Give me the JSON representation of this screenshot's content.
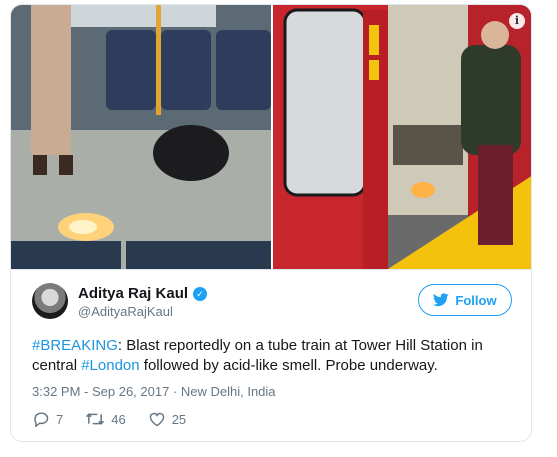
{
  "tweet": {
    "author_name": "Aditya Raj Kaul",
    "handle": "@AdityaRajKaul",
    "follow_label": "Follow",
    "hashtag_breaking": "#BREAKING",
    "text_part1": ": Blast reportedly on a tube train at Tower Hill Station in central ",
    "hashtag_london": "#London",
    "text_part2": " followed by acid-like smell. Probe underway.",
    "timestamp": "3:32 PM - Sep 26, 2017",
    "separator": " · ",
    "location": "New Delhi, India",
    "replies": "7",
    "retweets": "46",
    "likes": "25"
  },
  "colors": {
    "accent": "#1da1f2",
    "link": "#1b95e0",
    "secondary_text": "#657786",
    "border": "#e1e8ed"
  },
  "icons": {
    "verified": "verified-badge-icon",
    "follow": "twitter-bird-icon",
    "reply": "reply-icon",
    "retweet": "retweet-icon",
    "like": "heart-icon",
    "info": "info-icon"
  }
}
